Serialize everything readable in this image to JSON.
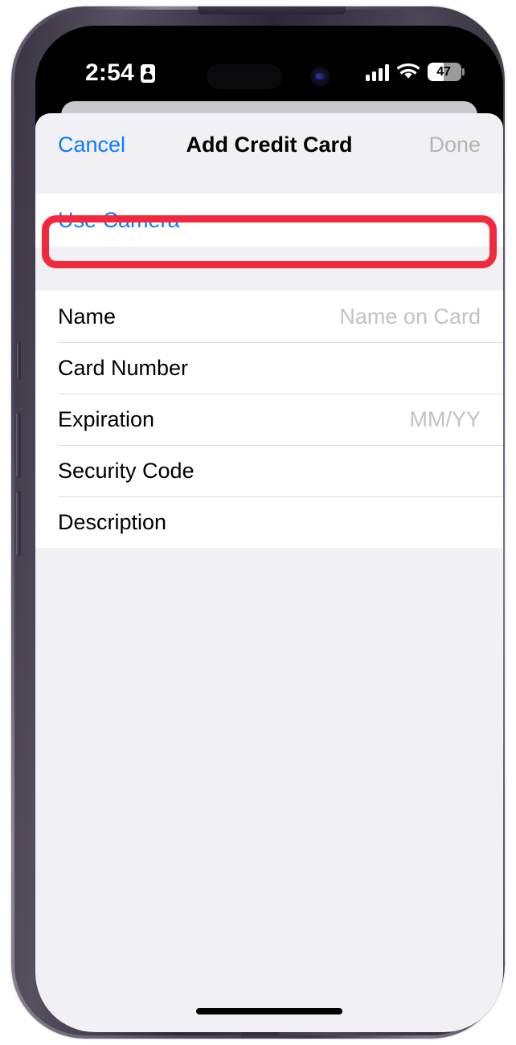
{
  "device": {
    "name": "iphone-15-pro",
    "frame_color": "#4a4252",
    "screen_background": "#000000"
  },
  "status_bar": {
    "time": "2:54",
    "location_icon": "location-indicator-icon",
    "cellular_icon": "cellular-signal-icon",
    "cellular_bars": 4,
    "wifi_icon": "wifi-icon",
    "battery_icon": "battery-icon",
    "battery_level": "47",
    "battery_percent": 47
  },
  "nav_bar": {
    "cancel_label": "Cancel",
    "title": "Add Credit Card",
    "done_label": "Done",
    "cancel_color": "#0a7cff",
    "done_color": "#b4b4b9"
  },
  "camera_group": {
    "use_camera_label": "Use Camera",
    "link_color": "#0a7cff"
  },
  "annotation": {
    "type": "rounded-rectangle-highlight",
    "color": "#f2283c",
    "target": "use-camera-row"
  },
  "form": {
    "rows": [
      {
        "label": "Name",
        "placeholder": "Name on Card"
      },
      {
        "label": "Card Number",
        "placeholder": ""
      },
      {
        "label": "Expiration",
        "placeholder": "MM/YY"
      },
      {
        "label": "Security Code",
        "placeholder": ""
      },
      {
        "label": "Description",
        "placeholder": ""
      }
    ]
  },
  "home_indicator": {
    "label": "home-indicator"
  },
  "colors": {
    "sheet_background": "#f1f1f5",
    "row_background": "#ffffff",
    "separator": "#dcdce0",
    "placeholder_text": "#c2c2c7",
    "accent_blue": "#0a7cff",
    "annotation_red": "#f2283c"
  }
}
